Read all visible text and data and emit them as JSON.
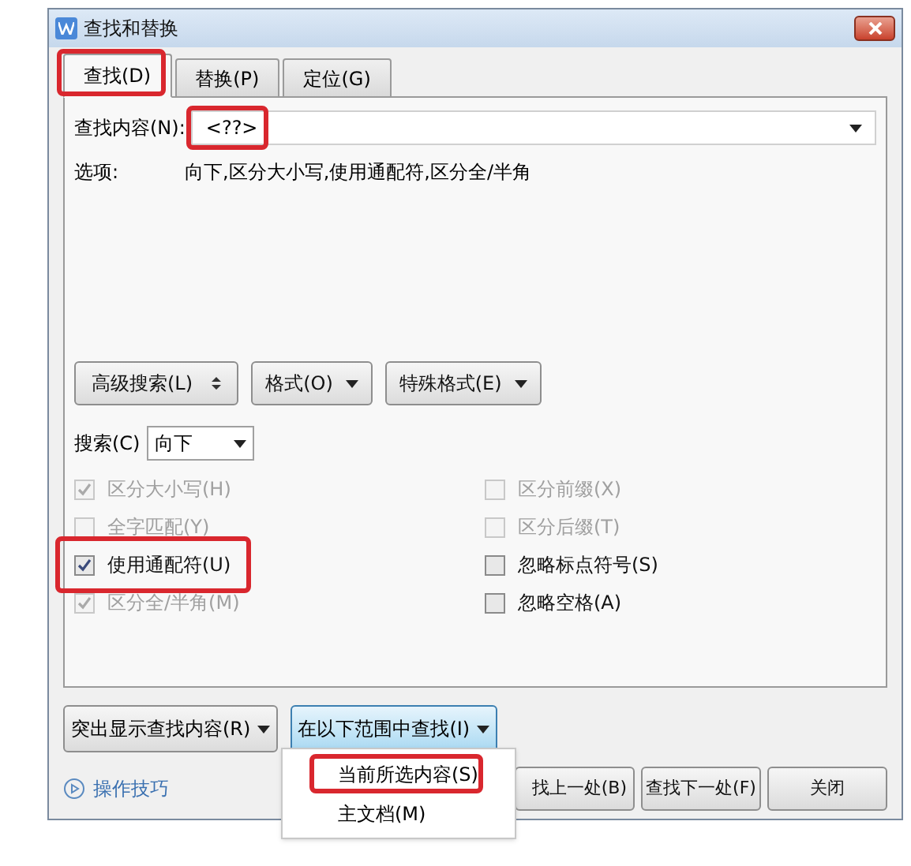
{
  "window": {
    "title": "查找和替换"
  },
  "tabs": [
    {
      "label": "查找(D)",
      "selected": true,
      "highlighted": true
    },
    {
      "label": "替换(P)",
      "selected": false,
      "highlighted": false
    },
    {
      "label": "定位(G)",
      "selected": false,
      "highlighted": false
    }
  ],
  "find_field": {
    "label": "查找内容(N):",
    "value": "<??>",
    "highlighted": true
  },
  "options": {
    "label": "选项:",
    "value": "向下,区分大小写,使用通配符,区分全/半角"
  },
  "action_buttons": [
    {
      "label": "高级搜索(L)",
      "kind": "toggle"
    },
    {
      "label": "格式(O)",
      "kind": "dropdown"
    },
    {
      "label": "特殊格式(E)",
      "kind": "dropdown"
    }
  ],
  "search_direction": {
    "label": "搜索(C)",
    "value": "向下"
  },
  "checkboxes": [
    {
      "label": "区分大小写(H)",
      "checked": true,
      "disabled": true,
      "highlighted": false
    },
    {
      "label": "区分前缀(X)",
      "checked": false,
      "disabled": true,
      "highlighted": false
    },
    {
      "label": "全字匹配(Y)",
      "checked": false,
      "disabled": true,
      "highlighted": false
    },
    {
      "label": "区分后缀(T)",
      "checked": false,
      "disabled": true,
      "highlighted": false
    },
    {
      "label": "使用通配符(U)",
      "checked": true,
      "disabled": false,
      "highlighted": true
    },
    {
      "label": "忽略标点符号(S)",
      "checked": false,
      "disabled": false,
      "highlighted": false
    },
    {
      "label": "区分全/半角(M)",
      "checked": true,
      "disabled": true,
      "highlighted": false
    },
    {
      "label": "忽略空格(A)",
      "checked": false,
      "disabled": false,
      "highlighted": false
    }
  ],
  "range_buttons": [
    {
      "label": "突出显示查找内容(R)",
      "selected": false
    },
    {
      "label": "在以下范围中查找(I)",
      "selected": true
    }
  ],
  "tips_link": "操作技巧",
  "bottom_buttons": [
    "找上一处(B)",
    "查找下一处(F)",
    "关闭"
  ],
  "menu": [
    {
      "label": "当前所选内容(S)",
      "highlighted": true
    },
    {
      "label": "主文档(M)",
      "highlighted": false
    }
  ]
}
